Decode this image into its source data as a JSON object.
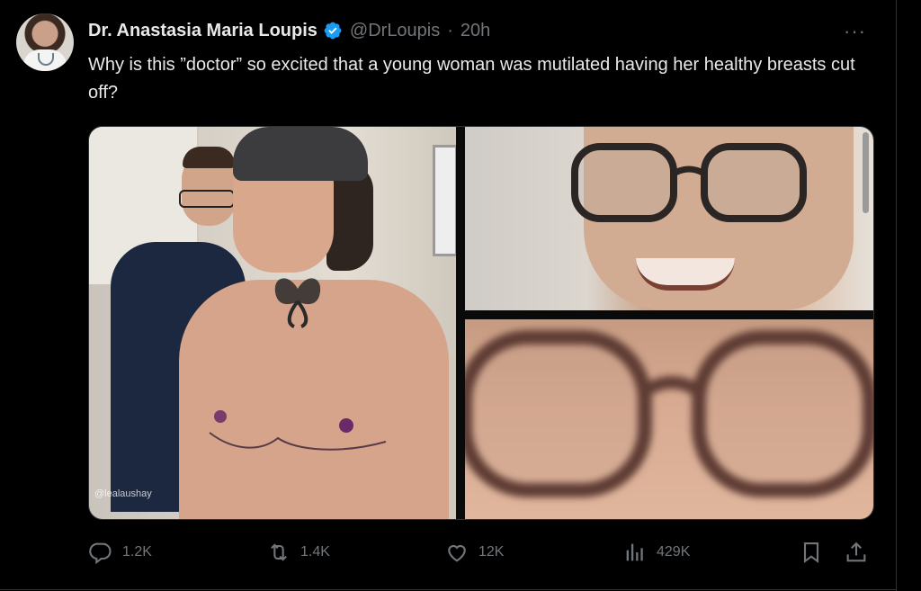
{
  "author": {
    "name": "Dr. Anastasia Maria Loupis",
    "handle": "@DrLoupis",
    "separator": "·",
    "time": "20h",
    "verified": true
  },
  "tweet": {
    "text": "Why is this ”doctor” so excited that a young woman was mutilated having her healthy  breasts cut off?"
  },
  "media": {
    "watermark": "@lealaushay"
  },
  "actions": {
    "replies": "1.2K",
    "reposts": "1.4K",
    "likes": "12K",
    "views": "429K"
  },
  "icons": [
    "more-icon",
    "verified-badge-icon",
    "reply-icon",
    "repost-icon",
    "like-icon",
    "views-icon",
    "bookmark-icon",
    "share-icon"
  ],
  "colors": {
    "background": "#000000",
    "text": "#e7e9ea",
    "secondary_text": "#71767b",
    "verified_blue": "#1d9bf0",
    "border": "#2f3336"
  }
}
